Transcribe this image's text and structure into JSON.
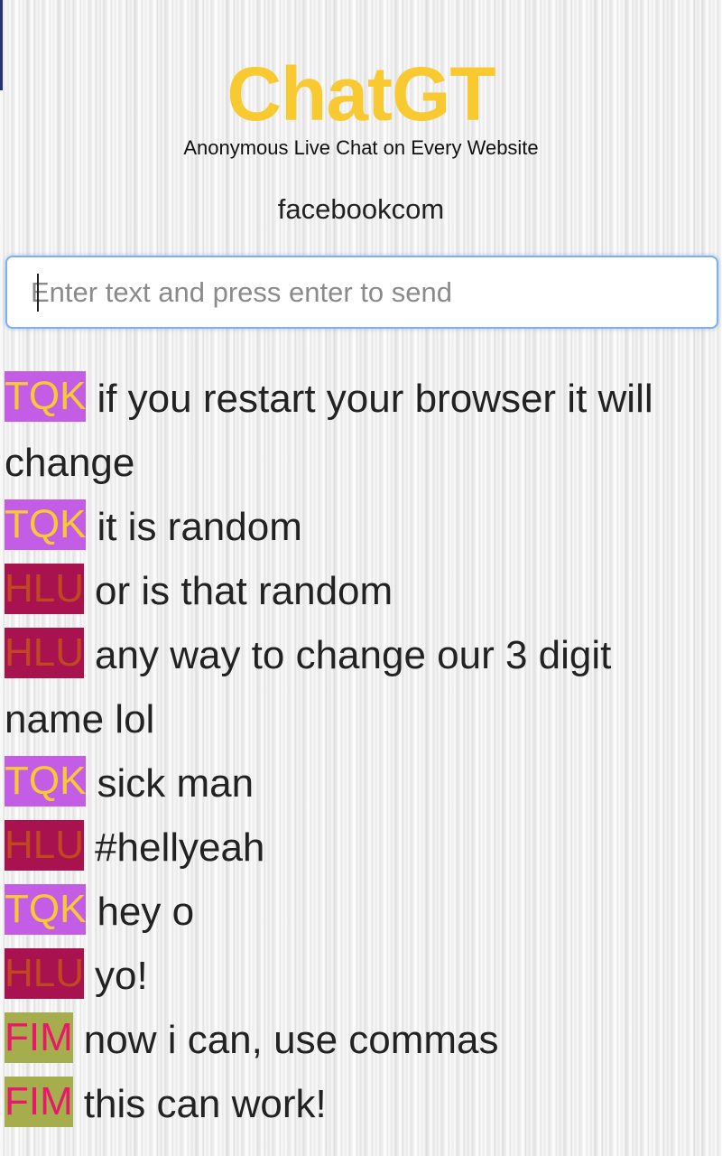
{
  "header": {
    "logo_text": "ChatGT",
    "tagline": "Anonymous Live Chat on Every Website",
    "site": "facebookcom"
  },
  "input": {
    "placeholder": "Enter text and press enter to send",
    "value": ""
  },
  "colors": {
    "logo": "#f9c931",
    "input_focus_border": "#7fb1e8",
    "users": {
      "TQK": {
        "bg": "#c35de6",
        "fg": "#f9c931"
      },
      "HLU": {
        "bg": "#a8124f",
        "fg": "#c0471f"
      },
      "FIM": {
        "bg": "#a6ad4c",
        "fg": "#e8186b"
      }
    }
  },
  "messages": [
    {
      "user": "TQK",
      "text": "if you restart your browser it will change"
    },
    {
      "user": "TQK",
      "text": "it is random"
    },
    {
      "user": "HLU",
      "text": "or is that random"
    },
    {
      "user": "HLU",
      "text": "any way to change our 3 digit name lol"
    },
    {
      "user": "TQK",
      "text": "sick man"
    },
    {
      "user": "HLU",
      "text": "#hellyeah"
    },
    {
      "user": "TQK",
      "text": "hey o"
    },
    {
      "user": "HLU",
      "text": "yo!"
    },
    {
      "user": "FIM",
      "text": "now i can, use commas"
    },
    {
      "user": "FIM",
      "text": "this can work!"
    }
  ]
}
